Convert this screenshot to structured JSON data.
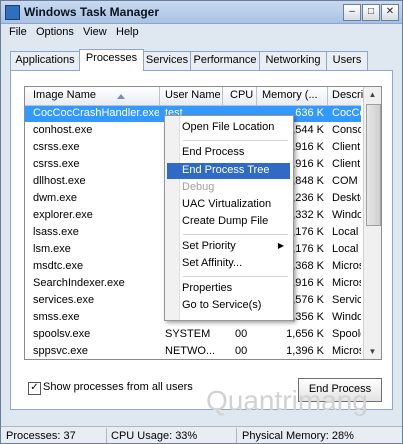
{
  "window": {
    "title": "Windows Task Manager"
  },
  "menu": [
    "File",
    "Options",
    "View",
    "Help"
  ],
  "tabs": [
    "Applications",
    "Processes",
    "Services",
    "Performance",
    "Networking",
    "Users"
  ],
  "table": {
    "headers": {
      "image": "Image Name",
      "user": "User Name",
      "cpu": "CPU",
      "memory": "Memory (...",
      "description": "Descri..."
    },
    "rows": [
      {
        "image": "CocCocCrashHandler.exe",
        "user": "test",
        "cpu": "",
        "memory": "636 K",
        "description": "CocCoc"
      },
      {
        "image": "conhost.exe",
        "user": "",
        "cpu": "",
        "memory": "1,544 K",
        "description": "Conso"
      },
      {
        "image": "csrss.exe",
        "user": "",
        "cpu": "",
        "memory": "1,916 K",
        "description": "Client"
      },
      {
        "image": "csrss.exe",
        "user": "",
        "cpu": "",
        "memory": "1,916 K",
        "description": "Client"
      },
      {
        "image": "dllhost.exe",
        "user": "",
        "cpu": "",
        "memory": "1,848 K",
        "description": "COM S"
      },
      {
        "image": "dwm.exe",
        "user": "",
        "cpu": "",
        "memory": "1,236 K",
        "description": "Deskto"
      },
      {
        "image": "explorer.exe",
        "user": "",
        "cpu": "",
        "memory": "1,332 K",
        "description": "Windo"
      },
      {
        "image": "lsass.exe",
        "user": "",
        "cpu": "",
        "memory": "1,176 K",
        "description": "Local S"
      },
      {
        "image": "lsm.exe",
        "user": "",
        "cpu": "",
        "memory": "1,176 K",
        "description": "Local S"
      },
      {
        "image": "msdtc.exe",
        "user": "",
        "cpu": "",
        "memory": "1,368 K",
        "description": "Micros"
      },
      {
        "image": "SearchIndexer.exe",
        "user": "",
        "cpu": "",
        "memory": "1,916 K",
        "description": "Micros"
      },
      {
        "image": "services.exe",
        "user": "",
        "cpu": "",
        "memory": "1,576 K",
        "description": "Servic"
      },
      {
        "image": "smss.exe",
        "user": "",
        "cpu": "",
        "memory": "1,356 K",
        "description": "Windo"
      },
      {
        "image": "spoolsv.exe",
        "user": "SYSTEM",
        "cpu": "00",
        "memory": "1,656 K",
        "description": "Spoole"
      },
      {
        "image": "sppsvc.exe",
        "user": "NETWO...",
        "cpu": "00",
        "memory": "1,396 K",
        "description": "Micros"
      }
    ]
  },
  "context_menu": {
    "items": [
      {
        "label": "Open File Location",
        "state": "normal"
      },
      {
        "label": "End Process",
        "state": "normal"
      },
      {
        "label": "End Process Tree",
        "state": "hover"
      },
      {
        "label": "Debug",
        "state": "disabled"
      },
      {
        "label": "UAC Virtualization",
        "state": "normal"
      },
      {
        "label": "Create Dump File",
        "state": "normal"
      },
      {
        "label": "Set Priority",
        "state": "normal",
        "submenu": true
      },
      {
        "label": "Set Affinity...",
        "state": "normal"
      },
      {
        "label": "Properties",
        "state": "normal"
      },
      {
        "label": "Go to Service(s)",
        "state": "normal"
      }
    ]
  },
  "checkbox": {
    "label": "Show processes from all users",
    "checked": true,
    "mark": "✓"
  },
  "buttons": {
    "end_process": "End Process"
  },
  "status": {
    "processes": "Processes: 37",
    "cpu": "CPU Usage: 33%",
    "memory": "Physical Memory: 28%"
  },
  "watermark": "Quantrimang",
  "colors": {
    "selection": "#3399ff",
    "menu_hover": "#316ac5"
  }
}
